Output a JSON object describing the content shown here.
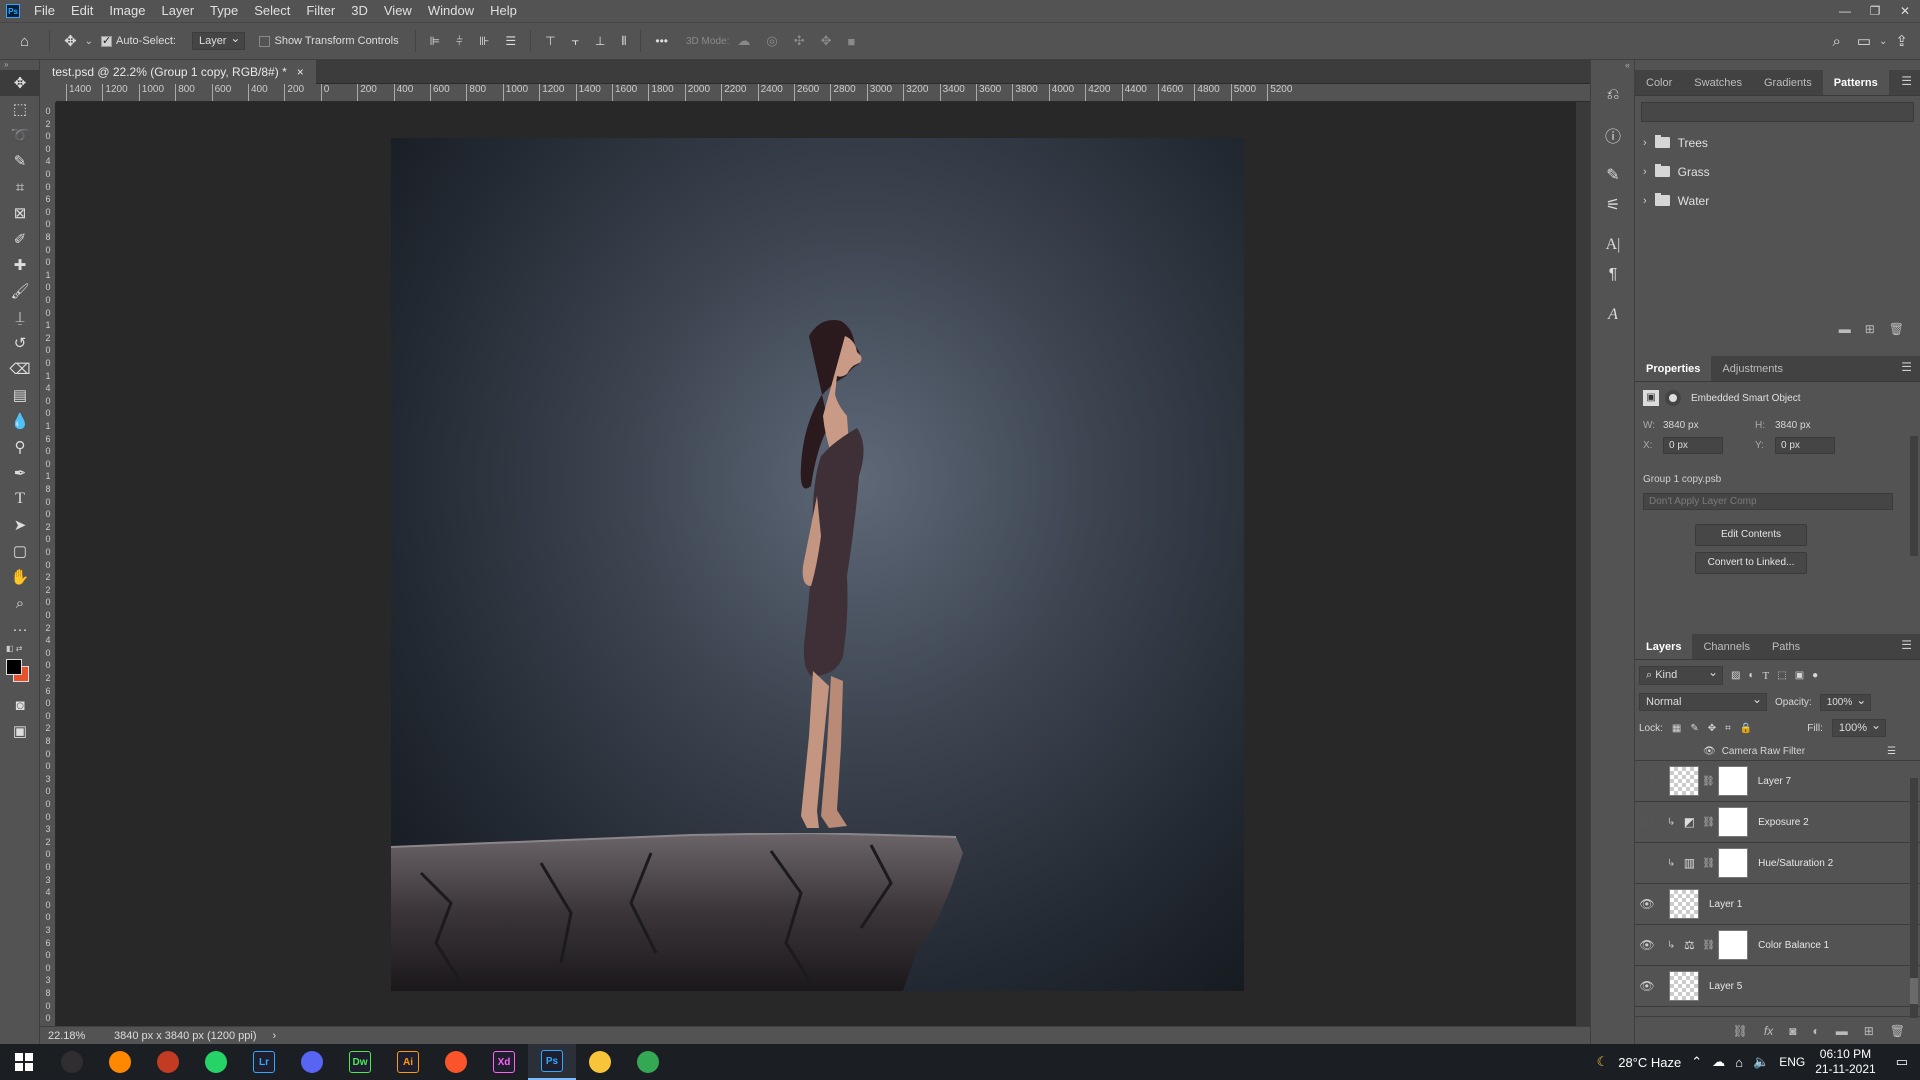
{
  "app": {
    "logo": "Ps",
    "menu": [
      "File",
      "Edit",
      "Image",
      "Layer",
      "Type",
      "Select",
      "Filter",
      "3D",
      "View",
      "Window",
      "Help"
    ]
  },
  "options": {
    "auto_select_label": "Auto-Select:",
    "auto_select_target": "Layer",
    "show_transform_label": "Show Transform Controls",
    "more": "•••",
    "mode_3d_label": "3D Mode:"
  },
  "document": {
    "tab_title": "test.psd @ 22.2% (Group 1 copy, RGB/8#) *",
    "close": "×"
  },
  "ruler": {
    "h_labels": [
      "1400",
      "1200",
      "1000",
      "800",
      "600",
      "400",
      "200",
      "0",
      "200",
      "400",
      "600",
      "800",
      "1000",
      "1200",
      "1400",
      "1600",
      "1800",
      "2000",
      "2200",
      "2400",
      "2600",
      "2800",
      "3000",
      "3200",
      "3400",
      "3600",
      "3800",
      "4000",
      "4200",
      "4400",
      "4600",
      "4800",
      "5000",
      "5200"
    ],
    "v_labels": [
      "0",
      "2",
      "0",
      "0",
      "4",
      "0",
      "0",
      "6",
      "0",
      "0",
      "8",
      "0",
      "0",
      "1",
      "0",
      "0",
      "0",
      "1",
      "2",
      "0",
      "0",
      "1",
      "4",
      "0",
      "0",
      "1",
      "6",
      "0",
      "0",
      "1",
      "8",
      "0",
      "0",
      "2",
      "0",
      "0",
      "0",
      "2",
      "2",
      "0",
      "0",
      "2",
      "4",
      "0",
      "0",
      "2",
      "6",
      "0",
      "0",
      "2",
      "8",
      "0",
      "0",
      "3",
      "0",
      "0",
      "0",
      "3",
      "2",
      "0",
      "0",
      "3",
      "4",
      "0",
      "0",
      "3",
      "6",
      "0",
      "0",
      "3",
      "8",
      "0",
      "0"
    ]
  },
  "status": {
    "zoom": "22.18%",
    "doc_size": "3840 px x 3840 px (1200 ppi)",
    "arrow": "›"
  },
  "patterns_panel": {
    "tabs": [
      "Color",
      "Swatches",
      "Gradients",
      "Patterns"
    ],
    "active_tab": "Patterns",
    "groups": [
      "Trees",
      "Grass",
      "Water"
    ]
  },
  "properties_panel": {
    "tabs": [
      "Properties",
      "Adjustments"
    ],
    "type_label": "Embedded Smart Object",
    "w_label": "W:",
    "w_value": "3840 px",
    "h_label": "H:",
    "h_value": "3840 px",
    "x_label": "X:",
    "x_value": "0 px",
    "y_label": "Y:",
    "y_value": "0 px",
    "filename": "Group 1 copy.psb",
    "layer_comp_placeholder": "Don't Apply Layer Comp",
    "edit_contents": "Edit Contents",
    "convert_linked": "Convert to Linked..."
  },
  "layers_panel": {
    "tabs": [
      "Layers",
      "Channels",
      "Paths"
    ],
    "filter_kind": "Kind",
    "blend_mode": "Normal",
    "opacity_label": "Opacity:",
    "opacity_value": "100%",
    "lock_label": "Lock:",
    "fill_label": "Fill:",
    "fill_value": "100%",
    "filter_row": "Camera Raw Filter",
    "layers": [
      {
        "name": "Layer 7",
        "visible": false,
        "thumb": "checker",
        "mask": true,
        "adj": ""
      },
      {
        "name": "Exposure 2",
        "visible": false,
        "thumb": "",
        "mask": true,
        "adj": "exposure-icon"
      },
      {
        "name": "Hue/Saturation 2",
        "visible": false,
        "thumb": "",
        "mask": true,
        "adj": "hue-saturation-icon"
      },
      {
        "name": "Layer 1",
        "visible": true,
        "thumb": "checker",
        "mask": false,
        "adj": ""
      },
      {
        "name": "Color Balance 1",
        "visible": true,
        "thumb": "",
        "mask": true,
        "adj": "color-balance-icon"
      },
      {
        "name": "Layer 5",
        "visible": true,
        "thumb": "checker",
        "mask": false,
        "adj": ""
      }
    ]
  },
  "taskbar": {
    "apps": [
      {
        "id": "windows-start",
        "label": "",
        "color": "#ffffff"
      },
      {
        "id": "obs",
        "label": "",
        "color": "#302e31"
      },
      {
        "id": "vlc",
        "label": "",
        "color": "#ff8800"
      },
      {
        "id": "photos",
        "label": "",
        "color": "#c23b22"
      },
      {
        "id": "whatsapp",
        "label": "",
        "color": "#25d366"
      },
      {
        "id": "lightroom",
        "label": "Lr",
        "color": "#31a8ff"
      },
      {
        "id": "discord",
        "label": "",
        "color": "#5865f2"
      },
      {
        "id": "dreamweaver",
        "label": "Dw",
        "color": "#4aea51"
      },
      {
        "id": "illustrator",
        "label": "Ai",
        "color": "#ff9a00"
      },
      {
        "id": "brave",
        "label": "",
        "color": "#fb542b"
      },
      {
        "id": "xd",
        "label": "Xd",
        "color": "#ff61f6"
      },
      {
        "id": "photoshop",
        "label": "Ps",
        "color": "#31a8ff"
      },
      {
        "id": "explorer",
        "label": "",
        "color": "#f8c43a"
      },
      {
        "id": "chrome",
        "label": "",
        "color": "#34a853"
      }
    ],
    "weather": "28°C  Haze",
    "lang": "ENG",
    "time": "06:10 PM",
    "date": "21-11-2021"
  }
}
